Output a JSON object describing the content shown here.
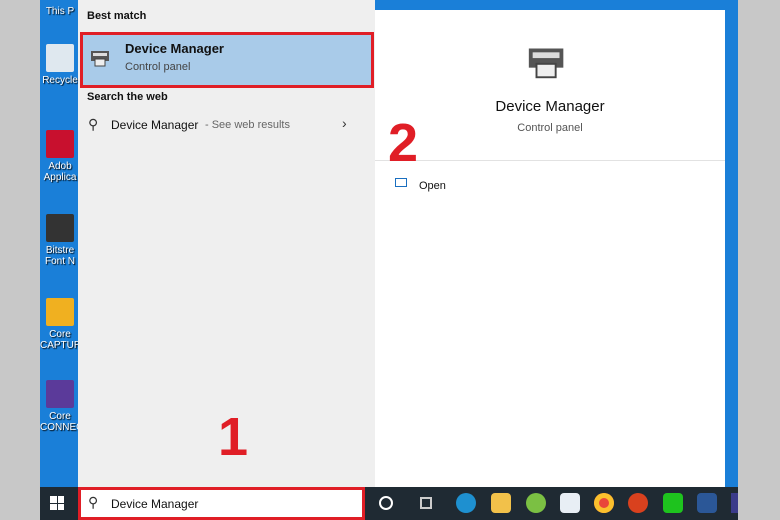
{
  "desktop": {
    "icons": [
      {
        "label": "This P"
      },
      {
        "label": "Recycle"
      },
      {
        "label": "Adob Applica"
      },
      {
        "label": "Bitstre Font N"
      },
      {
        "label": "Core CAPTUR"
      },
      {
        "label": "Core CONNEC"
      }
    ]
  },
  "results": {
    "best_match_header": "Best match",
    "best_match": {
      "title": "Device Manager",
      "subtitle": "Control panel"
    },
    "web_header": "Search the web",
    "web_item": {
      "title": "Device Manager",
      "suffix": "- See web results"
    }
  },
  "preview": {
    "title": "Device Manager",
    "subtitle": "Control panel",
    "open_label": "Open"
  },
  "annotations": {
    "step1": "1",
    "step2": "2"
  },
  "search": {
    "value": "Device Manager"
  },
  "taskbar": {
    "apps": [
      "cortana",
      "task-view",
      "edge",
      "file-explorer",
      "coccoc",
      "store",
      "chrome",
      "anydesk",
      "line",
      "word"
    ]
  },
  "colors": {
    "highlight": "#a9cbe9",
    "annotation": "#e01e26",
    "taskbar": "#1f2a33"
  }
}
